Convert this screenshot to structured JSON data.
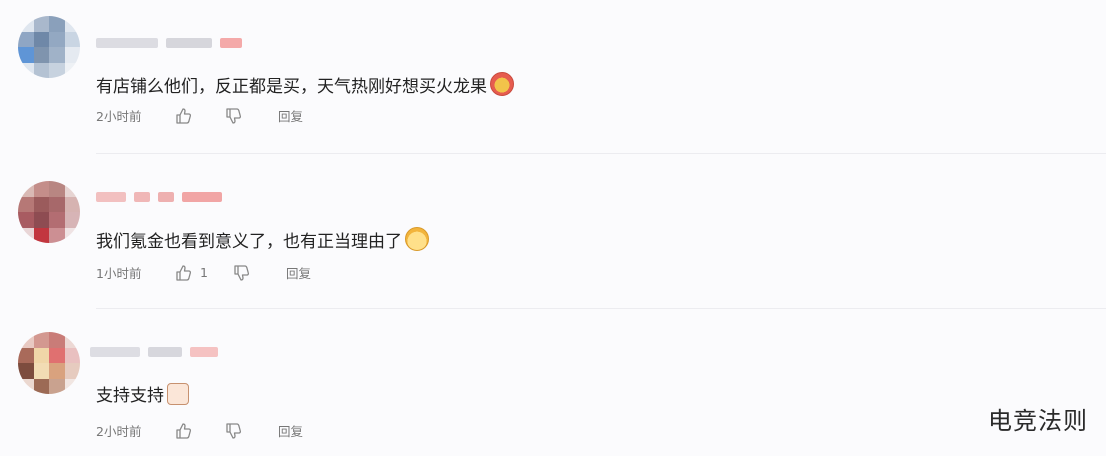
{
  "comments": [
    {
      "text": "有店铺么他们，反正都是买，天气热刚好想买火龙果",
      "emoji": "dragonfruit-emoji",
      "time": "2小时前",
      "like_count": "",
      "reply_label": "回复"
    },
    {
      "text": "我们氪金也看到意义了，也有正当理由了",
      "emoji": "cat-emoji",
      "time": "1小时前",
      "like_count": "1",
      "reply_label": "回复"
    },
    {
      "text": "支持支持",
      "emoji": "thumbs-up-emoji",
      "time": "2小时前",
      "like_count": "",
      "reply_label": "回复"
    }
  ],
  "watermark": "电竞法则",
  "colors": {
    "background": "#fbfbfd",
    "divider": "#ececf0",
    "meta_text": "#777777",
    "blur_gray": "#d8d8de",
    "blur_pink": "#f3b3b3"
  }
}
